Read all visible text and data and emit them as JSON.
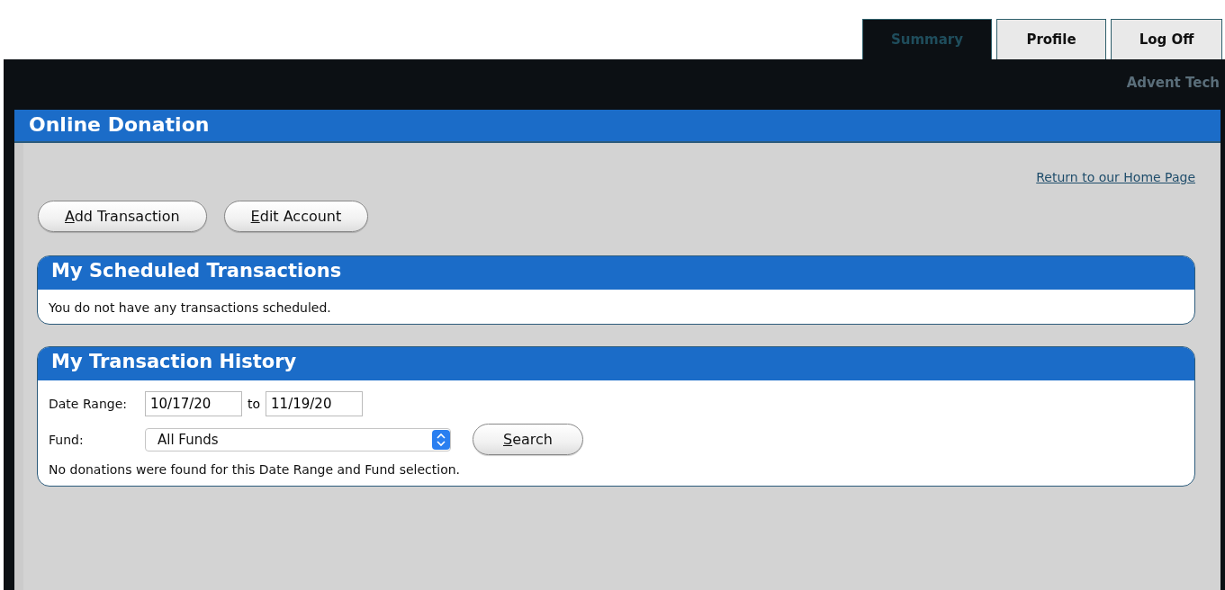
{
  "tabs": [
    {
      "label": "Summary",
      "selected": true
    },
    {
      "label": "Profile",
      "selected": false
    },
    {
      "label": "Log Off",
      "selected": false
    }
  ],
  "header": {
    "org_name": "Advent Tech"
  },
  "page": {
    "title": "Online Donation",
    "home_link": "Return to our Home Page"
  },
  "actions": [
    {
      "label": "Add Transaction",
      "underline_first": true
    },
    {
      "label": "Edit Account",
      "underline_first": true
    }
  ],
  "scheduled": {
    "title": "My Scheduled Transactions",
    "message": "You do not have any transactions scheduled."
  },
  "history": {
    "title": "My Transaction History",
    "date_label": "Date Range:",
    "date_from": "10/17/20",
    "to_label": "to",
    "date_to": "11/19/20",
    "fund_label": "Fund:",
    "fund_value": "All Funds",
    "search_button": {
      "label": "Search",
      "underline_first": true
    },
    "message": "No donations were found for this Date Range and Fund selection."
  }
}
